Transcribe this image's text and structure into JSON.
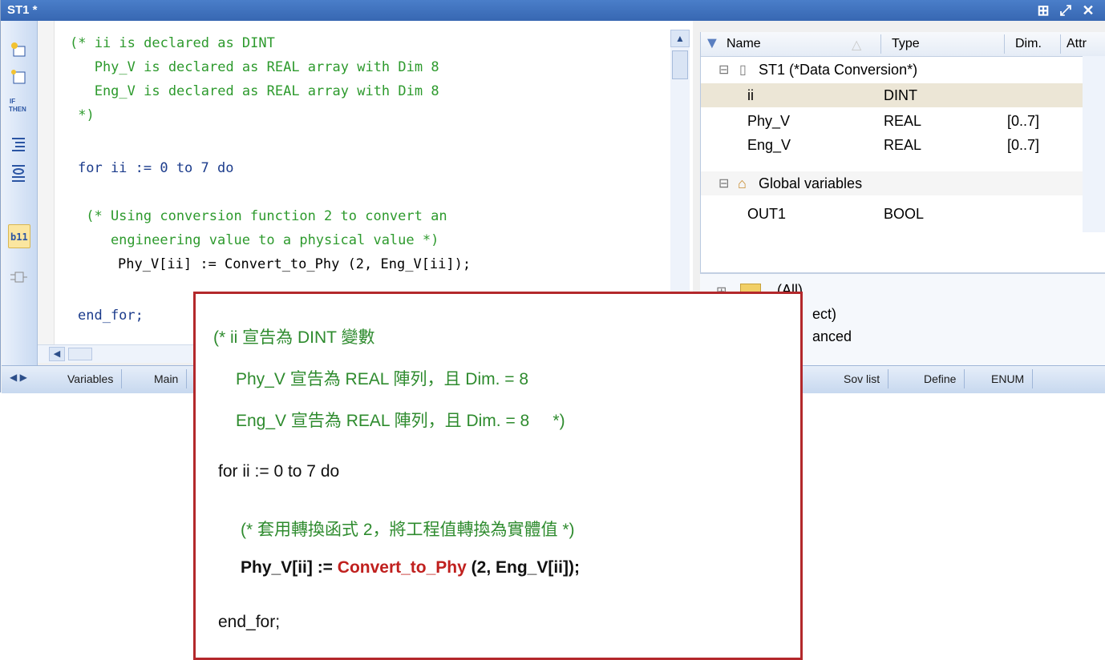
{
  "window": {
    "title": "ST1 *",
    "title_buttons": [
      "⊞",
      "⤢",
      "✕"
    ]
  },
  "editor": {
    "lines": [
      "(* ii is declared as DINT",
      "   Phy_V is declared as REAL array with Dim 8",
      "   Eng_V is declared as REAL array with Dim 8",
      " *)",
      "for ii := 0 to 7 do",
      " (* Using conversion function 2 to convert an",
      "    engineering value to a physical value *)",
      "Phy_V[ii] := Convert_to_Phy (2, Eng_V[ii]);",
      "end_for;"
    ]
  },
  "tabs": {
    "left": [
      "Variables",
      "Main"
    ],
    "right": [
      "Sov list",
      "Define",
      "ENUM"
    ]
  },
  "var_table": {
    "columns": [
      "Name",
      "Type",
      "Dim.",
      "Attr"
    ],
    "group1": "ST1 (*Data Conversion*)",
    "rows": [
      {
        "name": "ii",
        "type": "DINT",
        "dim": ""
      },
      {
        "name": "Phy_V",
        "type": "REAL",
        "dim": "[0..7]"
      },
      {
        "name": "Eng_V",
        "type": "REAL",
        "dim": "[0..7]"
      }
    ],
    "group2": "Global variables",
    "global_rows": [
      {
        "name": "OUT1",
        "type": "BOOL",
        "dim": ""
      }
    ]
  },
  "lower_panel": {
    "items": [
      "(All)",
      "ect)",
      "anced"
    ]
  },
  "overlay": {
    "l1": "(* ii 宣告為 DINT 變數",
    "l2": "Phy_V 宣告為 REAL 陣列，且 Dim. = 8",
    "l3": "Eng_V 宣告為 REAL 陣列，且 Dim. = 8     *)",
    "l4": "for ii := 0 to 7 do",
    "l5": "(* 套用轉換函式 2，將工程值轉換為實體值 *)",
    "l6a": "Phy_V[ii] := ",
    "l6b": "Convert_to_Phy",
    "l6c": " (2, Eng_V[ii]);",
    "l7": "end_for;"
  }
}
